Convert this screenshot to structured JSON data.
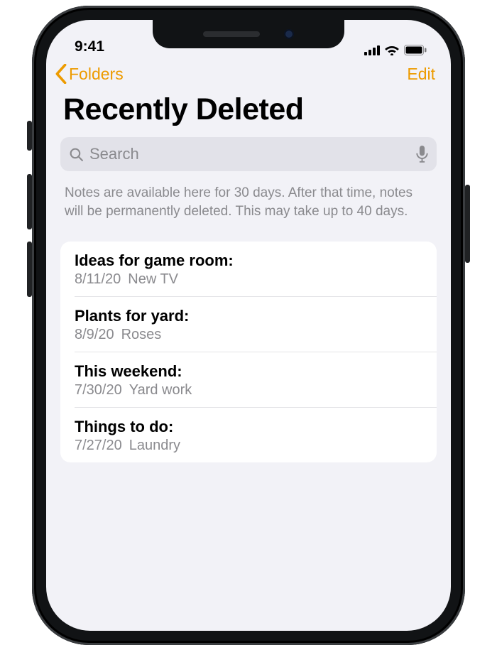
{
  "statusbar": {
    "time": "9:41"
  },
  "nav": {
    "back_label": "Folders",
    "edit_label": "Edit"
  },
  "title": "Recently Deleted",
  "search": {
    "placeholder": "Search"
  },
  "info_text": "Notes are available here for 30 days. After that time, notes will be permanently deleted. This may take up to 40 days.",
  "notes": [
    {
      "title": "Ideas for game room:",
      "date": "8/11/20",
      "preview": "New TV"
    },
    {
      "title": "Plants for yard:",
      "date": "8/9/20",
      "preview": "Roses"
    },
    {
      "title": "This weekend:",
      "date": "7/30/20",
      "preview": "Yard work"
    },
    {
      "title": "Things to do:",
      "date": "7/27/20",
      "preview": "Laundry"
    }
  ]
}
